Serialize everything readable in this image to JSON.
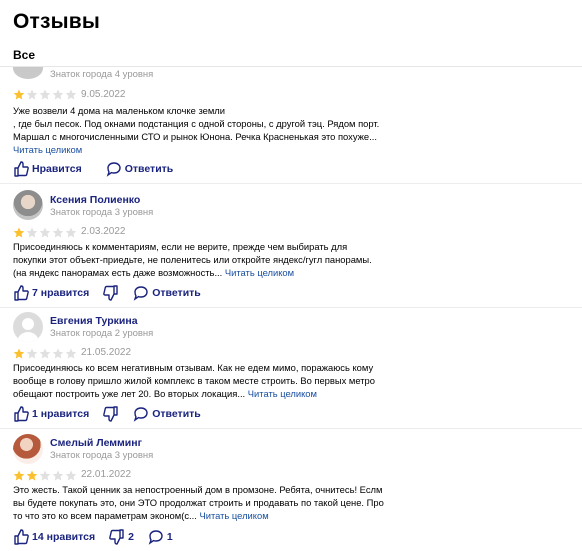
{
  "header": {
    "title": "Отзывы"
  },
  "tabs": {
    "all_label": "Все"
  },
  "reviews": [
    {
      "author": "",
      "level": "Знаток города 4 уровня",
      "rating": 1,
      "date": "9.05.2022",
      "lines": [
        "Уже возвели 4 дома на маленьком клочке земли",
        ", где был песок. Под окнами подстанция с одной стороны, с другой тэц. Рядом порт.",
        "Маршал с многочисленными СТО и рынок Юнона. Речка Красненькая это похуже..."
      ],
      "read_more": "Читать целиком",
      "like_label": "Нравится",
      "reply_label": "Ответить"
    },
    {
      "author": "Ксения Полиенко",
      "level": "Знаток города 3 уровня",
      "rating": 1,
      "date": "2.03.2022",
      "lines": [
        "Присоединяюсь к комментариям, если не верите, прежде чем выбирать для",
        "покупки этот объект-приедьте, не поленитесь или откройте яндекс/гугл панорамы.",
        "(на яндекс панорамах есть даже возможность..."
      ],
      "read_more": "Читать целиком",
      "like_label": "7 нравится",
      "reply_label": "Ответить"
    },
    {
      "author": "Евгения Туркина",
      "level": "Знаток города 2 уровня",
      "rating": 1,
      "date": "21.05.2022",
      "lines": [
        "Присоединяюсь ко всем негативным отзывам. Как не едем мимо, поражаюсь кому",
        "вообще в голову пришло жилой комплекс в таком месте строить. Во первых метро",
        "обещают построить уже лет 20. Во вторых локация..."
      ],
      "read_more": "Читать целиком",
      "like_label": "1 нравится",
      "reply_label": "Ответить"
    },
    {
      "author": "Смелый Лемминг",
      "level": "Знаток города 3 уровня",
      "rating": 2,
      "date": "22.01.2022",
      "lines": [
        "Это жесть. Такой ценник за непостроенный дом в промзоне. Ребята, очнитесь! Еслм",
        "вы будете покупать это, они ЭТО продолжат строить и продавать по такой цене. Про",
        "то что это ко всем параметрам эконом(с..."
      ],
      "read_more": "Читать целиком",
      "like_label": "14 нравится",
      "dislike_count": "2",
      "comment_count": "1"
    }
  ],
  "colors": {
    "star_filled": "#fbc02d",
    "star_empty": "#e0e0e0",
    "link": "#1a4fa0",
    "name": "#1a237e"
  }
}
